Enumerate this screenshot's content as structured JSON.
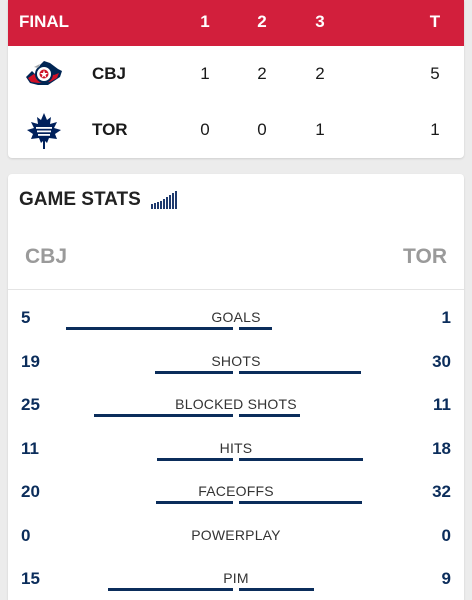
{
  "scoreboard": {
    "status": "FINAL",
    "periods": [
      "1",
      "2",
      "3"
    ],
    "total_label": "T",
    "header_color": "#d21f3c",
    "teams": [
      {
        "abbr": "CBJ",
        "logo": "blue-jackets-logo",
        "p1": "1",
        "p2": "2",
        "p3": "2",
        "total": "5"
      },
      {
        "abbr": "TOR",
        "logo": "maple-leafs-logo",
        "p1": "0",
        "p2": "0",
        "p3": "1",
        "total": "1"
      }
    ]
  },
  "game_stats": {
    "title": "GAME STATS",
    "title_icon": "bar-chart-icon",
    "home_abbr": "CBJ",
    "away_abbr": "TOR",
    "bar_color": "#0b2d5b",
    "stats": [
      {
        "label": "GOALS",
        "left": "5",
        "right": "1"
      },
      {
        "label": "SHOTS",
        "left": "19",
        "right": "30"
      },
      {
        "label": "BLOCKED SHOTS",
        "left": "25",
        "right": "11"
      },
      {
        "label": "HITS",
        "left": "11",
        "right": "18"
      },
      {
        "label": "FACEOFFS",
        "left": "20",
        "right": "32"
      },
      {
        "label": "POWERPLAY",
        "left": "0",
        "right": "0"
      },
      {
        "label": "PIM",
        "left": "15",
        "right": "9"
      }
    ]
  }
}
